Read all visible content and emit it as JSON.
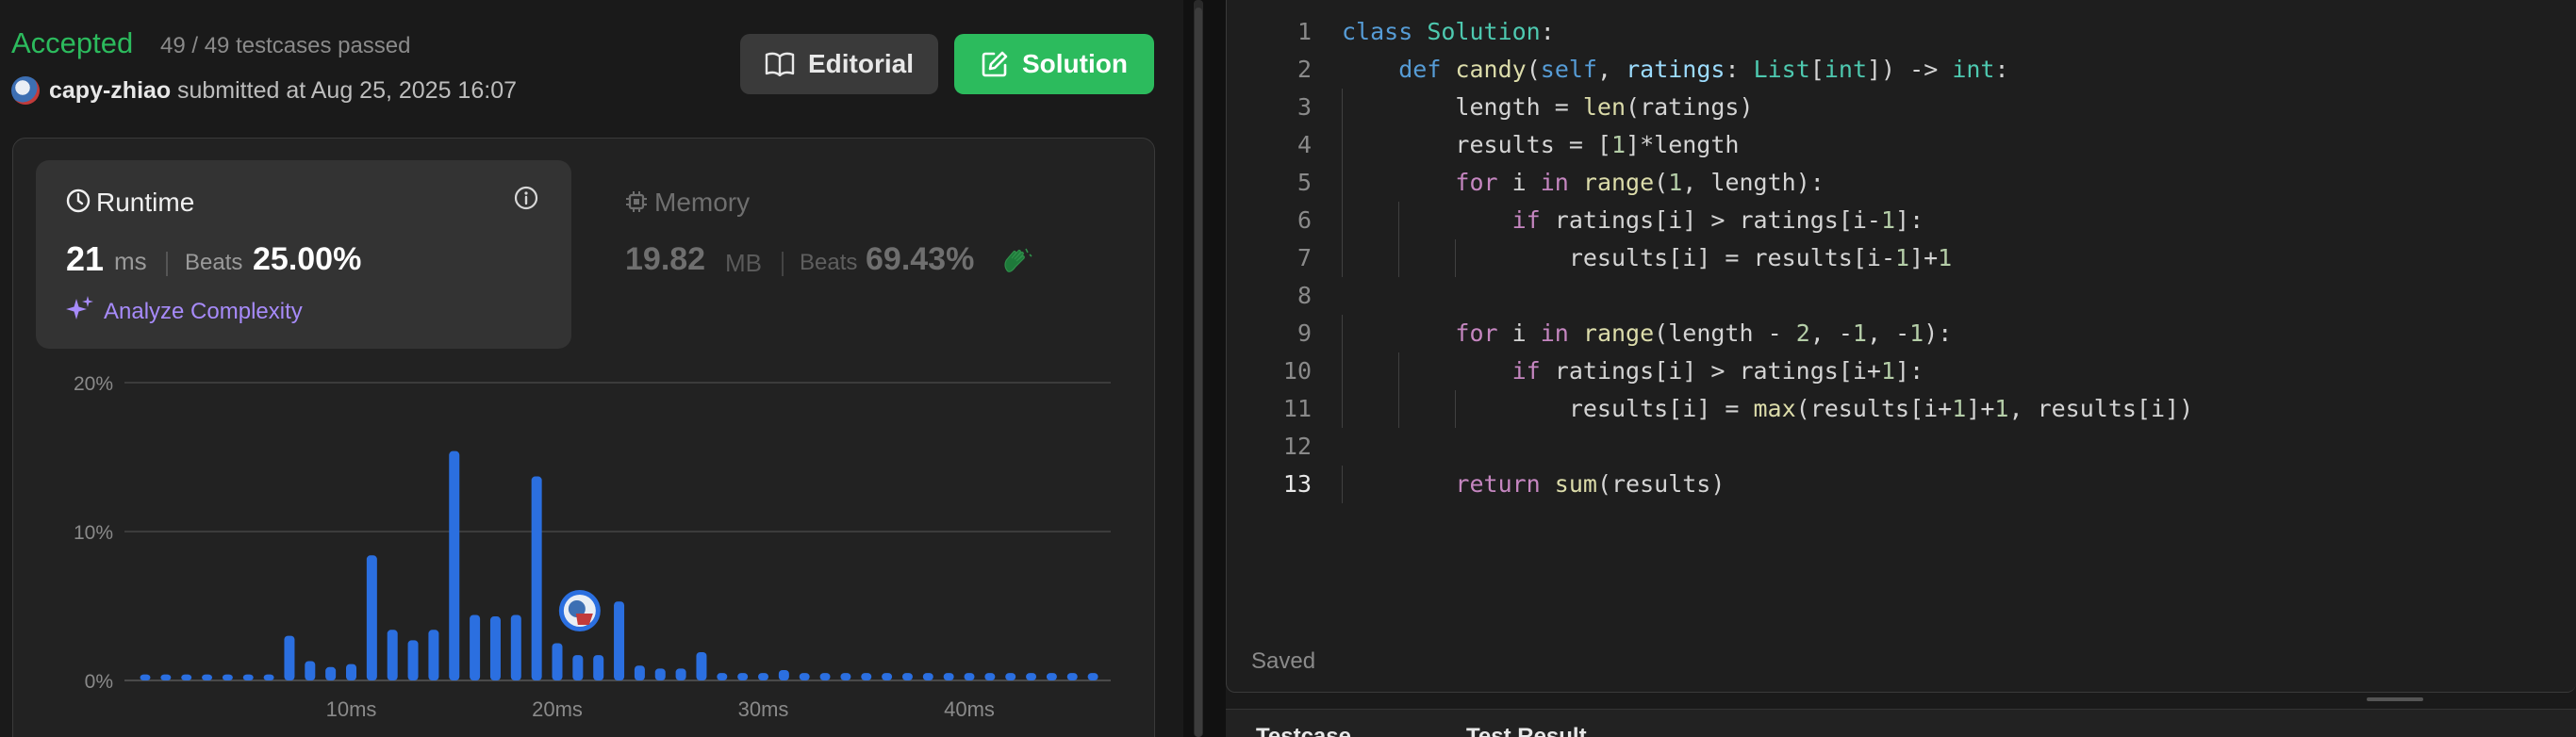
{
  "submission": {
    "status": "Accepted",
    "testcases": "49 / 49 testcases passed",
    "user": "capy-zhiao",
    "submitted_at": "submitted at Aug 25, 2025 16:07"
  },
  "actions": {
    "editorial": "Editorial",
    "solution": "Solution"
  },
  "runtime": {
    "label": "Runtime",
    "value": "21",
    "unit": "ms",
    "beats_label": "Beats",
    "beats": "25.00%",
    "analyze": "Analyze Complexity"
  },
  "memory": {
    "label": "Memory",
    "value": "19.82",
    "unit": "MB",
    "beats_label": "Beats",
    "beats": "69.43%"
  },
  "chart_data": {
    "type": "bar",
    "y_ticks": [
      "0%",
      "10%",
      "20%"
    ],
    "x_ticks": [
      "10ms",
      "20ms",
      "30ms",
      "40ms"
    ],
    "ylim": [
      0,
      20
    ],
    "x_start_ms": 0,
    "x_step_ms": 1,
    "values": [
      0.4,
      0.4,
      0.4,
      0.4,
      0.4,
      0.4,
      0.4,
      3,
      1.3,
      0.9,
      1.1,
      8.4,
      3.4,
      2.7,
      3.4,
      15.4,
      4.4,
      4.3,
      4.4,
      13.7,
      2.5,
      1.7,
      1.7,
      5.3,
      1,
      0.8,
      0.8,
      1.9,
      0.5,
      0.5,
      0.5,
      0.7,
      0.5,
      0.5,
      0.5,
      0.5,
      0.5,
      0.5,
      0.5,
      0.5,
      0.5,
      0.5,
      0.5,
      0.5,
      0.5,
      0.5,
      0.5
    ],
    "user_marker_ms": 21,
    "bar_color": "#2b6fe0"
  },
  "editor": {
    "lines": [
      "class Solution:",
      "    def candy(self, ratings: List[int]) -> int:",
      "        length = len(ratings)",
      "        results = [1]*length",
      "        for i in range(1, length):",
      "            if ratings[i] > ratings[i-1]:",
      "                results[i] = results[i-1]+1",
      "",
      "        for i in range(length - 2, -1, -1):",
      "            if ratings[i] > ratings[i+1]:",
      "                results[i] = max(results[i+1]+1, results[i])",
      "",
      "        return sum(results)"
    ],
    "active_line": 13,
    "saved_status": "Saved"
  },
  "bottom_tabs": {
    "testcase": "Testcase",
    "result": "Test Result"
  },
  "colors": {
    "accepted": "#2cbb5d",
    "accent_purple": "#a78bfa",
    "bar": "#2b6fe0"
  }
}
